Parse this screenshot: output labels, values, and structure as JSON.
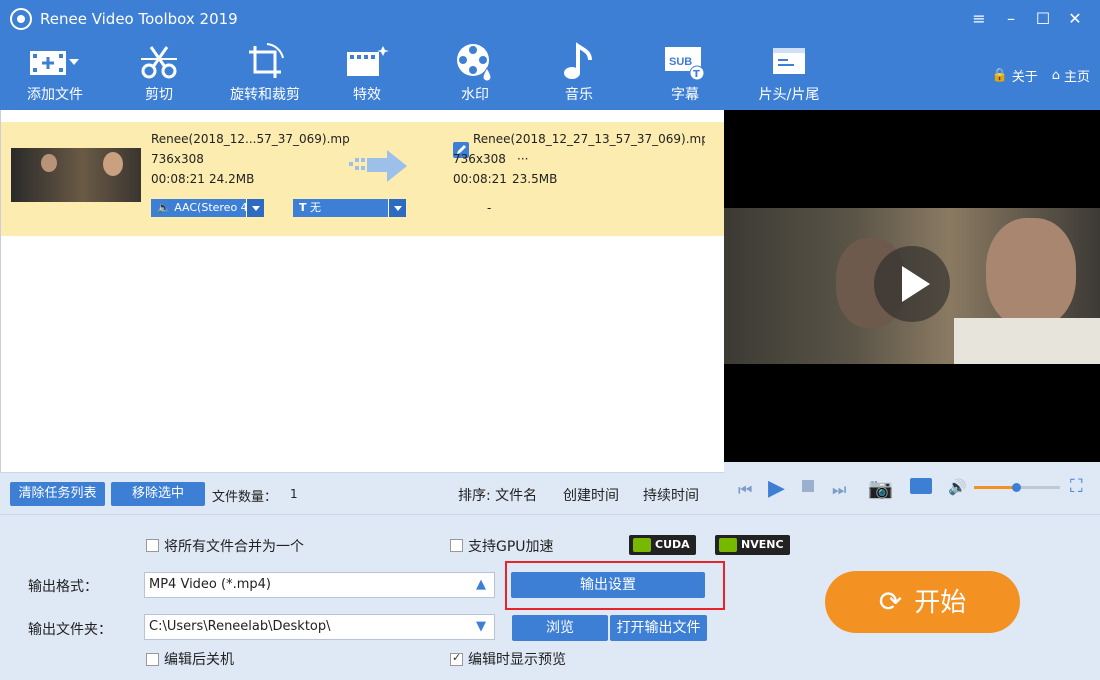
{
  "window": {
    "title": "Renee Video Toolbox 2019"
  },
  "toolbar": {
    "items": [
      {
        "label": "添加文件",
        "icon": "add-file-icon"
      },
      {
        "label": "剪切",
        "icon": "scissors-icon"
      },
      {
        "label": "旋转和裁剪",
        "icon": "rotate-crop-icon"
      },
      {
        "label": "特效",
        "icon": "effects-icon"
      },
      {
        "label": "水印",
        "icon": "watermark-icon"
      },
      {
        "label": "音乐",
        "icon": "music-note-icon"
      },
      {
        "label": "字幕",
        "icon": "subtitle-icon"
      },
      {
        "label": "片头/片尾",
        "icon": "intro-outro-icon"
      }
    ],
    "about": "关于",
    "home": "主页"
  },
  "file": {
    "src_name": "Renee(2018_12...57_37_069).mp",
    "src_res": "736x308",
    "src_dur": "00:08:21",
    "src_size": "24.2MB",
    "dst_name": "Renee(2018_12_27_13_57_37_069).mp",
    "dst_res": "736x308",
    "dst_res_more": "···",
    "dst_dur": "00:08:21",
    "dst_size": "23.5MB",
    "audio": "AAC(Stereo 4",
    "subtitle": "无",
    "dash": "-"
  },
  "listbar": {
    "clear": "清除任务列表",
    "remove": "移除选中",
    "count_label": "文件数量：",
    "count": "1",
    "sort_label": "排序: 文件名",
    "sort_created": "创建时间",
    "sort_duration": "持续时间"
  },
  "options": {
    "merge": "将所有文件合并为一个",
    "gpu": "支持GPU加速",
    "cuda": "CUDA",
    "nvenc": "NVENC",
    "format_label": "输出格式：",
    "format_value": "MP4 Video (*.mp4)",
    "output_settings": "输出设置",
    "folder_label": "输出文件夹：",
    "folder_value": "C:\\Users\\Reneelab\\Desktop\\",
    "browse": "浏览",
    "open_folder": "打开输出文件",
    "shutdown": "编辑后关机",
    "preview": "编辑时显示预览",
    "start": "开始"
  },
  "colors": {
    "accent": "#3e7fd6",
    "start": "#f39222",
    "highlight_box": "#e8232a"
  }
}
